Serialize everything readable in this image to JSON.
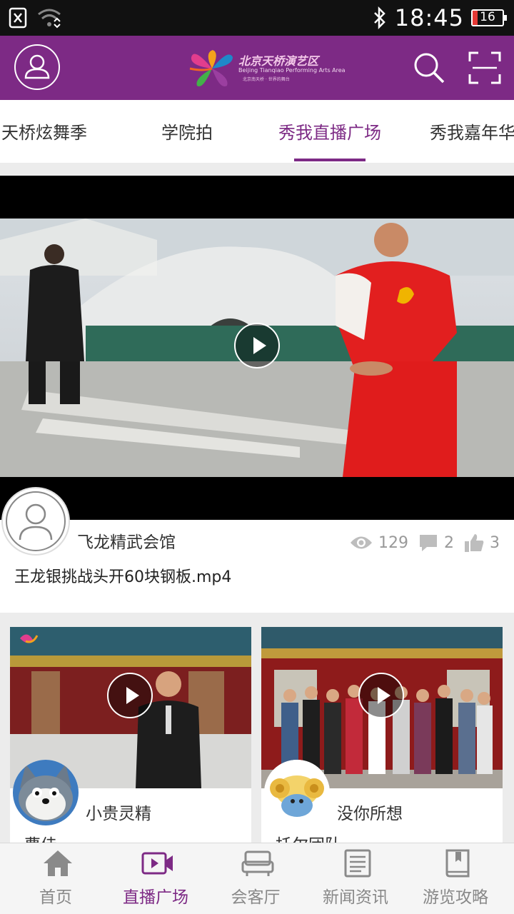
{
  "status_bar": {
    "time": "18:45",
    "battery": "16",
    "icons": [
      "sim-none-icon",
      "wifi-icon",
      "bluetooth-icon",
      "battery-icon"
    ]
  },
  "header": {
    "logo_title": "北京天桥演艺区",
    "logo_subtitle": "Beijing Tianqiao Performing Arts Area",
    "logo_tagline": "北京南天桥 · 世界的舞台",
    "icons": [
      "profile-icon",
      "search-icon",
      "scan-icon"
    ],
    "accent_color": "#7d2a85"
  },
  "tabs": [
    {
      "label": "天桥炫舞季"
    },
    {
      "label": "学院拍"
    },
    {
      "label": "秀我直播广场",
      "active": true
    },
    {
      "label": "秀我嘉年华"
    }
  ],
  "featured": {
    "author": "飞龙精武会馆",
    "views": "129",
    "comments": "2",
    "likes": "3",
    "title": "王龙银挑战头开60块钢板.mp4"
  },
  "cards": [
    {
      "author": "小贵灵精",
      "title": "曹佳"
    },
    {
      "author": "没你所想",
      "title": "托尔团队"
    }
  ],
  "bottom_nav": [
    {
      "label": "首页",
      "icon": "home-icon"
    },
    {
      "label": "直播广场",
      "icon": "video-camera-icon",
      "active": true
    },
    {
      "label": "会客厅",
      "icon": "sofa-icon"
    },
    {
      "label": "新闻资讯",
      "icon": "news-icon"
    },
    {
      "label": "游览攻略",
      "icon": "guide-book-icon"
    }
  ]
}
